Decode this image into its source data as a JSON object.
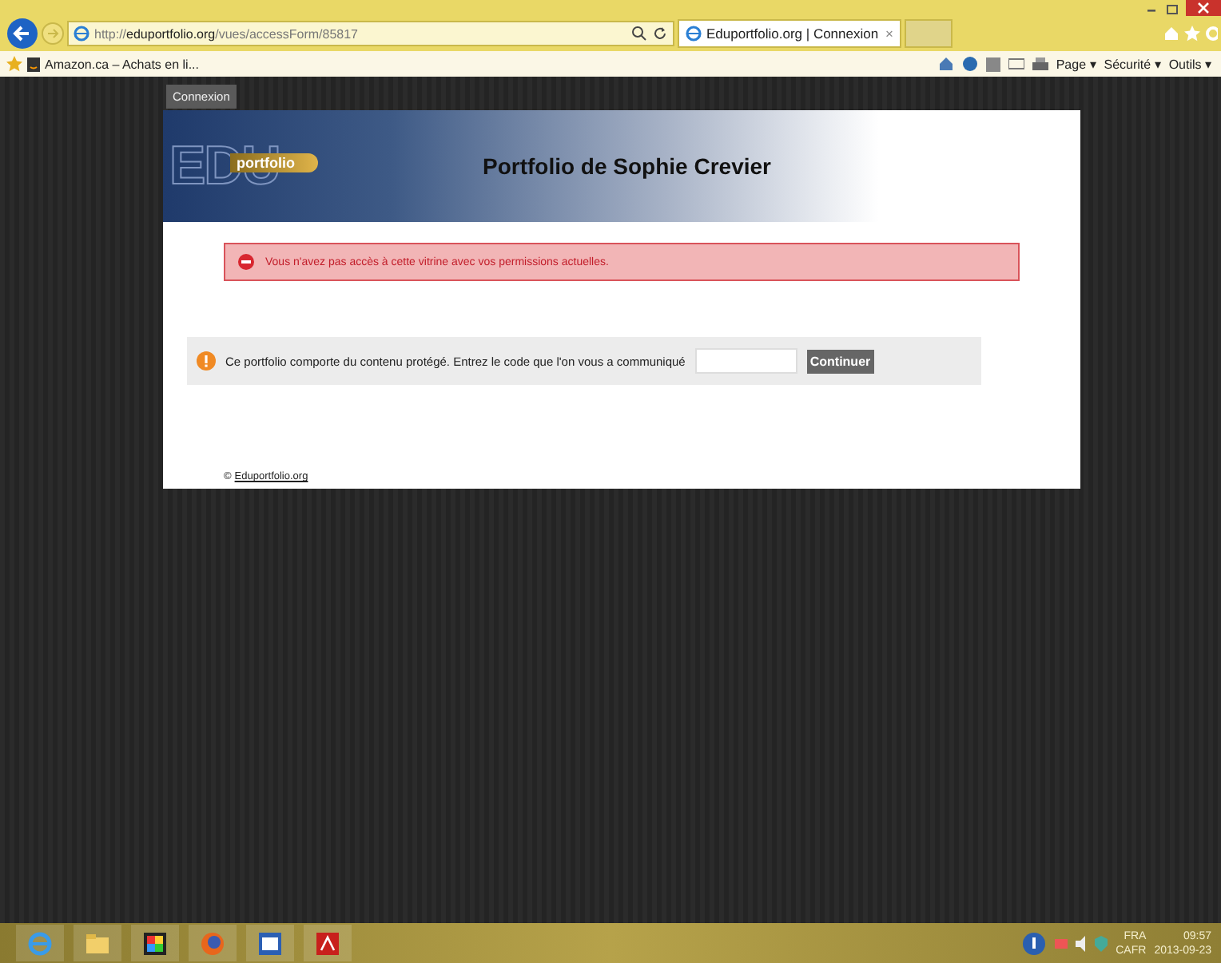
{
  "browser": {
    "url": {
      "scheme": "http://",
      "domain": "eduportfolio.org",
      "path": "/vues/accessForm/85817"
    },
    "tabs": [
      {
        "title": "Eduportfolio.org | Connexion",
        "close": "×",
        "selected": true
      }
    ],
    "favorites": [
      {
        "label": "Amazon.ca – Achats en li..."
      }
    ],
    "commands": [
      {
        "label": "Page ▾"
      },
      {
        "label": "Sécurité ▾"
      },
      {
        "label": "Outils ▾"
      }
    ]
  },
  "page": {
    "top_tab": "Connexion",
    "logo": {
      "big": "EDU",
      "small": "portfolio"
    },
    "title": "Portfolio de Sophie Crevier",
    "error": "Vous n'avez pas accès à cette vitrine avec vos permissions actuelles.",
    "notice": "Ce portfolio comporte du contenu protégé. Entrez le code que l'on vous a communiqué",
    "button": "Continuer",
    "footer": {
      "symbol": "©",
      "link": "Eduportfolio.org"
    }
  },
  "taskbar": {
    "language": "FRA",
    "layout": "CAFR",
    "time": "09:57",
    "date": "2013-09-23"
  }
}
